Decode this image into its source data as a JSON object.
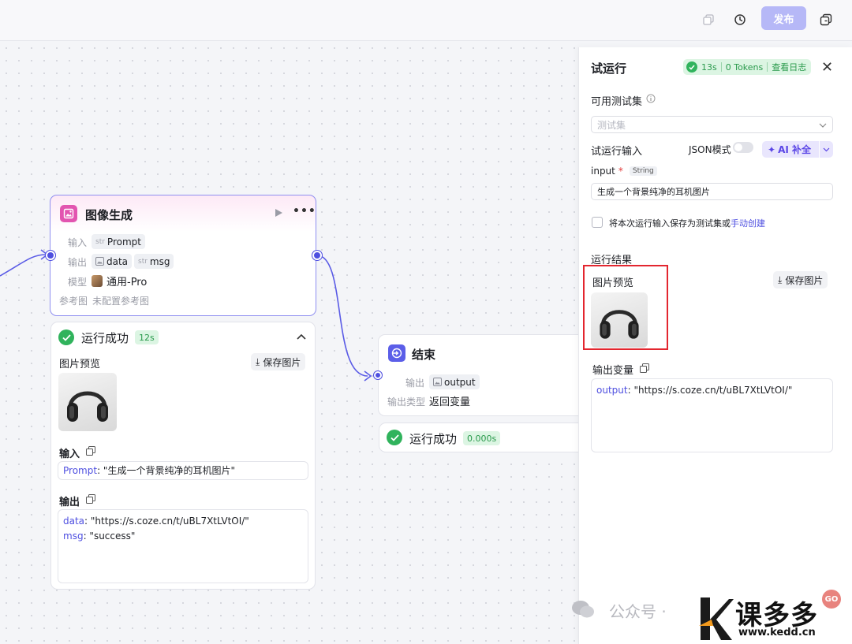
{
  "toolbar": {
    "publish_label": "发布"
  },
  "image_node": {
    "title": "图像生成",
    "input_label": "输入",
    "input_type": "str",
    "input_value": "Prompt",
    "output_label": "输出",
    "output_1": "data",
    "output_2_type": "str",
    "output_2": "msg",
    "model_label": "模型",
    "model_value": "通用-Pro",
    "ref_label": "参考图",
    "ref_value": "未配置参考图"
  },
  "image_result": {
    "status": "运行成功",
    "time": "12s",
    "preview_label": "图片预览",
    "save_label": "保存图片",
    "input_heading": "输入",
    "input_key": "Prompt",
    "input_value": ": \"生成一个背景纯净的耳机图片\"",
    "output_heading": "输出",
    "output_lines": [
      {
        "key": "data",
        "value": ": \"https://s.coze.cn/t/uBL7XtLVtOI/\""
      },
      {
        "key": "msg",
        "value": ": \"success\""
      }
    ]
  },
  "end_node": {
    "title": "结束",
    "output_label": "输出",
    "output_value": "output",
    "output_type_label": "输出类型",
    "output_type_value": "返回变量",
    "status": "运行成功",
    "time": "0.000s"
  },
  "panel": {
    "title": "试运行",
    "duration": "13s",
    "tokens": "0 Tokens",
    "view_log": "查看日志",
    "testset_label": "可用测试集",
    "testset_placeholder": "测试集",
    "run_input_label": "试运行输入",
    "json_mode": "JSON模式",
    "ai_label": "AI 补全",
    "input_name": "input",
    "input_required": "*",
    "input_type": "String",
    "input_value": "生成一个背景纯净的耳机图片",
    "save_text": "将本次运行输入保存为测试集或",
    "manual_link": "手动创建",
    "results_label": "运行结果",
    "preview_label": "图片预览",
    "save_image": "保存图片",
    "output_var_label": "输出变量",
    "output_key": "output",
    "output_value": ": \"https://s.coze.cn/t/uBL7XtLVtOI/\""
  },
  "watermark": {
    "wechat": "公众号 · ",
    "site_name": "课多多",
    "site_url": "www.kedd.cn",
    "badge": "GO"
  }
}
